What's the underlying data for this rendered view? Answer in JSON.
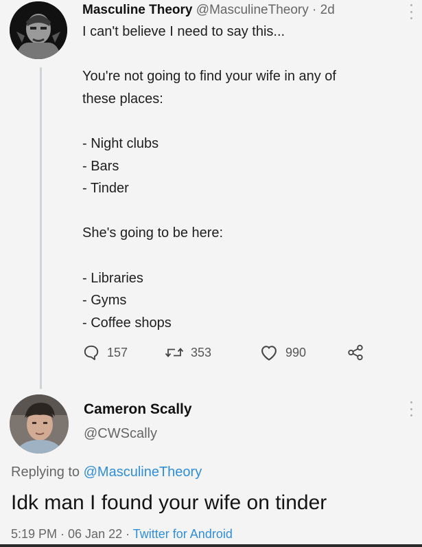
{
  "tweet": {
    "author_name": "Masculine Theory",
    "author_handle": "@MasculineTheory",
    "separator": " · ",
    "time_ago": "2d",
    "lines": [
      "I can't believe I need to say this...",
      "",
      "You're not going to find your wife in any of",
      "these places:",
      "",
      "- Night clubs",
      "- Bars",
      "- Tinder",
      "",
      "She's going to be here:",
      "",
      "- Libraries",
      "- Gyms",
      "- Coffee shops"
    ],
    "replies": "157",
    "retweets": "353",
    "likes": "990",
    "icons": {
      "reply": "comment-bubble-icon",
      "retweet": "retweet-icon",
      "like": "heart-icon",
      "share": "share-icon",
      "more": "more-options-icon"
    }
  },
  "reply": {
    "author_name": "Cameron Scally",
    "author_handle": "@CWScally",
    "replying_to_label": "Replying to ",
    "replying_to_handle": "@MasculineTheory",
    "text": "Idk man I found your wife on tinder",
    "time": "5:19 PM · 06 Jan 22 · ",
    "source": "Twitter for Android"
  },
  "colors": {
    "background": "#f4f4f4",
    "link": "#2f8ed8",
    "muted": "#666666",
    "thread_line": "#cfd4d8"
  }
}
